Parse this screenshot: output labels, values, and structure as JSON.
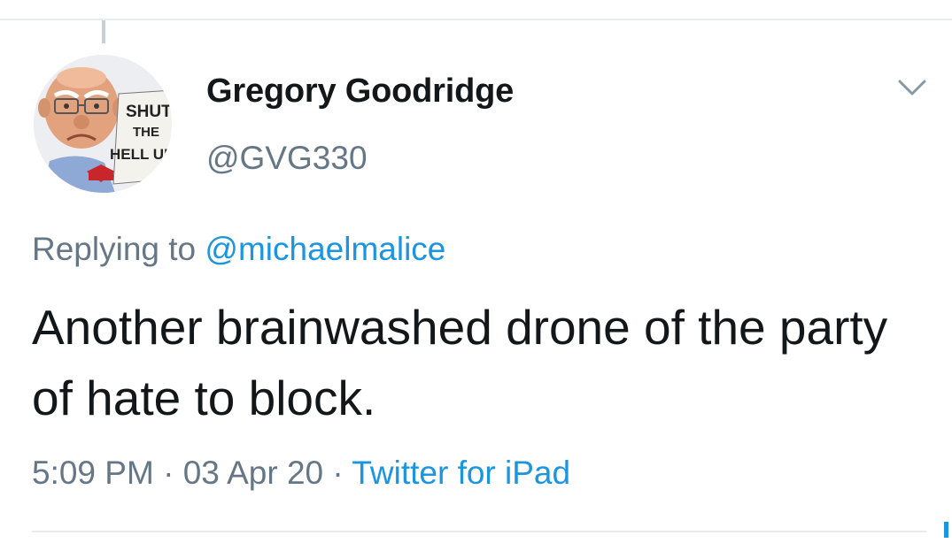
{
  "tweet": {
    "author": {
      "display_name": "Gregory Goodridge",
      "handle": "@GVG330",
      "avatar_sign": [
        "SHUT",
        "THE",
        "HELL UP"
      ]
    },
    "menu_icon": "chevron-down-icon",
    "reply": {
      "prefix": "Replying to",
      "mention": "@michaelmalice"
    },
    "text": "Another brainwashed drone of the party of hate to block.",
    "meta": {
      "time": "5:09 PM",
      "separator": "·",
      "date": "03 Apr 20",
      "source": "Twitter for iPad"
    }
  },
  "colors": {
    "text_primary": "#14171a",
    "text_secondary": "#657786",
    "link": "#1b95e0",
    "divider": "#e6ecf0"
  }
}
